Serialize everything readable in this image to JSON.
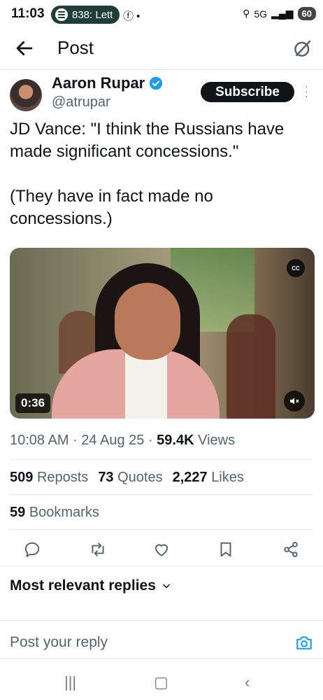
{
  "status_bar": {
    "time": "11:03",
    "notification": "838: Lett",
    "network": "5G",
    "battery": "60"
  },
  "header": {
    "title": "Post"
  },
  "author": {
    "name": "Aaron Rupar",
    "handle": "@atrupar",
    "subscribe_label": "Subscribe"
  },
  "tweet": {
    "text": "JD Vance: \"I think the Russians have made significant concessions.\"\n\n(They have in fact made no concessions.)"
  },
  "video": {
    "duration": "0:36",
    "cc_label": "CC"
  },
  "meta": {
    "time": "10:08 AM",
    "date": "24 Aug 25",
    "views_count": "59.4K",
    "views_label": "Views"
  },
  "stats": {
    "reposts_count": "509",
    "reposts_label": "Reposts",
    "quotes_count": "73",
    "quotes_label": "Quotes",
    "likes_count": "2,227",
    "likes_label": "Likes",
    "bookmarks_count": "59",
    "bookmarks_label": "Bookmarks"
  },
  "replies": {
    "sort_label": "Most relevant replies",
    "reply_placeholder": "Post your reply"
  },
  "icons": [
    "back-arrow-icon",
    "grok-icon",
    "verified-icon",
    "more-icon",
    "cc-icon",
    "mute-icon",
    "reply-icon",
    "repost-icon",
    "like-icon",
    "bookmark-icon",
    "share-icon",
    "chevron-down-icon",
    "camera-icon"
  ],
  "colors": {
    "accent": "#1d9bf0",
    "text": "#0f1419",
    "secondary": "#536471",
    "status_pill": "#1f3f36"
  }
}
